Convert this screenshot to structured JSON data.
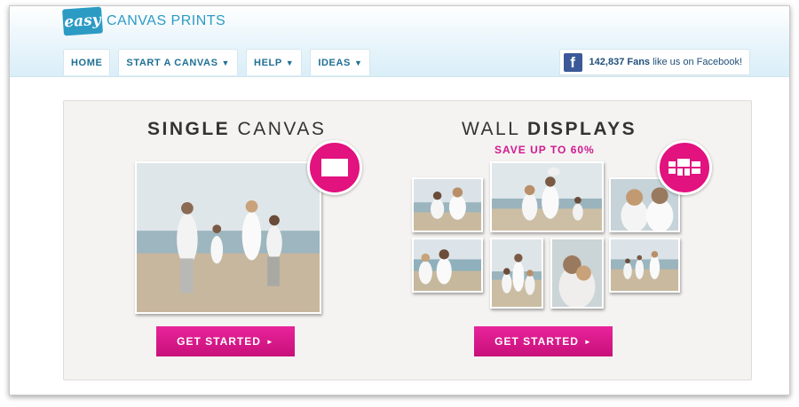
{
  "logo": {
    "badge": "easy",
    "text": "CANVAS PRINTS"
  },
  "nav": [
    {
      "label": "HOME",
      "caret": ""
    },
    {
      "label": "START A CANVAS",
      "caret": "▼"
    },
    {
      "label": "HELP",
      "caret": "▼"
    },
    {
      "label": "IDEAS",
      "caret": "▼"
    }
  ],
  "facebook": {
    "icon_letter": "f",
    "count": "142,837 Fans",
    "text": "like us on Facebook!"
  },
  "single": {
    "title_bold": "SINGLE",
    "title_light": "CANVAS",
    "button": "GET STARTED",
    "button_arrow": "►",
    "icon": "single-canvas-icon"
  },
  "wall": {
    "title_light": "WALL",
    "title_bold": "DISPLAYS",
    "promo": "SAVE UP TO 60%",
    "button": "GET STARTED",
    "button_arrow": "►",
    "icon": "wall-grid-icon"
  },
  "colors": {
    "accent": "#e2127f",
    "brand_blue": "#2c9bc4",
    "facebook": "#3b5998"
  }
}
